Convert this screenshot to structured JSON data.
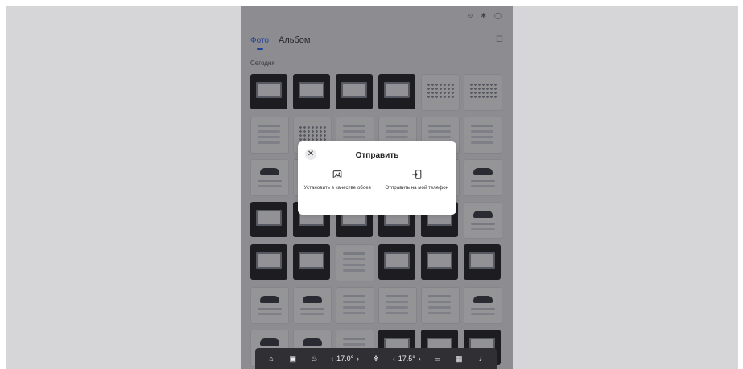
{
  "status_icons": [
    "alert-icon",
    "settings-icon",
    "profile-icon"
  ],
  "tabs": [
    {
      "label": "Фото",
      "active": true
    },
    {
      "label": "Альбом",
      "active": false
    }
  ],
  "section": {
    "label": "Сегодня"
  },
  "thumbnails": [
    "dark",
    "dark",
    "dark",
    "dark",
    "dots",
    "dots",
    "light",
    "dots",
    "light",
    "light",
    "light",
    "light",
    "car",
    "light",
    "light",
    "light",
    "light",
    "car",
    "dark",
    "dark",
    "dark",
    "dark",
    "dark",
    "car",
    "dark",
    "dark",
    "light",
    "dark",
    "dark",
    "dark",
    "car",
    "car",
    "light",
    "light",
    "light",
    "car",
    "car",
    "car",
    "light",
    "dark",
    "dark",
    "dark"
  ],
  "dialog": {
    "title": "Отправить",
    "close_icon": "close-icon",
    "actions": [
      {
        "label": "Установить в качестве обоев",
        "icon": "image-icon"
      },
      {
        "label": "Отправить на мой телефон",
        "icon": "phone-send-icon"
      }
    ]
  },
  "dock": {
    "items": [
      "home-icon",
      "car-icon",
      "defrost-icon"
    ],
    "temp_left": "17.0°",
    "fan_icon": "fan-icon",
    "temp_right": "17.5°",
    "right_items": [
      "screen-icon",
      "apps-icon",
      "music-icon"
    ]
  },
  "colors": {
    "accent": "#2a62ff",
    "dock": "#2f2f34",
    "overlay": "rgba(25,25,30,0.45)"
  }
}
